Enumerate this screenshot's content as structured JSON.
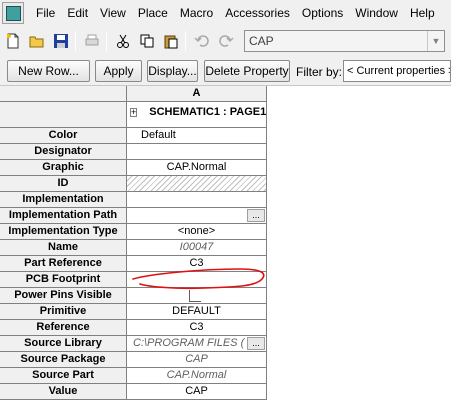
{
  "menu": {
    "items": [
      "File",
      "Edit",
      "View",
      "Place",
      "Macro",
      "Accessories",
      "Options",
      "Window",
      "Help"
    ]
  },
  "toolbar": {
    "icons": [
      "new-file-icon",
      "open-folder-icon",
      "save-icon",
      "print-icon",
      "cut-icon",
      "copy-icon",
      "paste-icon",
      "undo-icon",
      "redo-icon"
    ],
    "part_combo_value": "CAP"
  },
  "buttons": {
    "new_row": "New Row...",
    "apply": "Apply",
    "display": "Display...",
    "delete_property": "Delete Property",
    "filter_label": "Filter by:",
    "filter_value": "< Current properties >"
  },
  "grid": {
    "column_header": "A",
    "expand_symbol": "+",
    "group_label": "SCHEMATIC1 : PAGE1",
    "rows": [
      {
        "name": "Color",
        "value": ""
      },
      {
        "name": "Designator",
        "value": ""
      },
      {
        "name": "Graphic",
        "value": "CAP.Normal"
      },
      {
        "name": "ID",
        "value": ""
      },
      {
        "name": "Implementation",
        "value": ""
      },
      {
        "name": "Implementation Path",
        "value": ""
      },
      {
        "name": "Implementation Type",
        "value": "<none>"
      },
      {
        "name": "Name",
        "value": "I00047"
      },
      {
        "name": "Part Reference",
        "value": "C3"
      },
      {
        "name": "PCB Footprint",
        "value": ""
      },
      {
        "name": "Power Pins Visible",
        "value": ""
      },
      {
        "name": "Primitive",
        "value": "DEFAULT"
      },
      {
        "name": "Reference",
        "value": "C3"
      },
      {
        "name": "Source Library",
        "value": "C:\\PROGRAM FILES ("
      },
      {
        "name": "Source Package",
        "value": "CAP"
      },
      {
        "name": "Source Part",
        "value": "CAP.Normal"
      },
      {
        "name": "Value",
        "value": "CAP"
      }
    ],
    "color_value": "Default",
    "ellipsis": "..."
  },
  "colors": {
    "annotation_red": "#e01010",
    "header_bg": "#f0f0f0",
    "grid_line": "#808080"
  }
}
